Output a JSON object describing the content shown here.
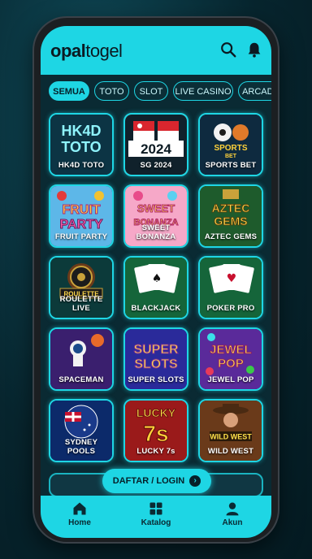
{
  "header": {
    "logo_bold": "opal",
    "logo_light": "togel"
  },
  "tabs": [
    {
      "label": "SEMUA",
      "active": true
    },
    {
      "label": "TOTO",
      "active": false
    },
    {
      "label": "SLOT",
      "active": false
    },
    {
      "label": "LIVE CASINO",
      "active": false
    },
    {
      "label": "ARCADE",
      "active": false
    }
  ],
  "games": [
    {
      "label": "HK4D TOTO"
    },
    {
      "label": "SG 2024"
    },
    {
      "label": "SPORTS BET"
    },
    {
      "label": "FRUIT PARTY"
    },
    {
      "label": "SWEET BONANZA"
    },
    {
      "label": "AZTEC GEMS"
    },
    {
      "label": "ROULETTE LIVE"
    },
    {
      "label": "BLACKJACK"
    },
    {
      "label": "POKER PRO"
    },
    {
      "label": "SPACEMAN"
    },
    {
      "label": "SUPER SLOTS"
    },
    {
      "label": "JEWEL POP"
    },
    {
      "label": "SYDNEY POOLS"
    },
    {
      "label": "LUCKY 7s"
    },
    {
      "label": "WILD WEST"
    }
  ],
  "art_text": {
    "hk4d": "HK4D",
    "toto": "TOTO",
    "sg_year": "2024",
    "sports": "SPORTS",
    "bet": "BET",
    "fruit": "FRUIT",
    "party": "PARTY",
    "sweet": "SWEET",
    "bonanza": "BONANZA",
    "aztec": "AZTEC",
    "gems": "GEMS",
    "roulette": "ROULETTE",
    "super": "SUPER",
    "slots": "SLOTS",
    "jewel": "JEWEL",
    "pop": "POP",
    "lucky": "LUCKY",
    "sevens": "7s",
    "wild_west": "WILD WEST"
  },
  "cta": {
    "label": "DAFTAR / LOGIN",
    "arrow": "›"
  },
  "bottom_nav": [
    {
      "label": "Home",
      "icon": "home-icon"
    },
    {
      "label": "Katalog",
      "icon": "grid-icon"
    },
    {
      "label": "Akun",
      "icon": "user-icon"
    }
  ],
  "colors": {
    "accent": "#1ed6e4",
    "bg": "#0a2a33",
    "dark": "#062029"
  }
}
